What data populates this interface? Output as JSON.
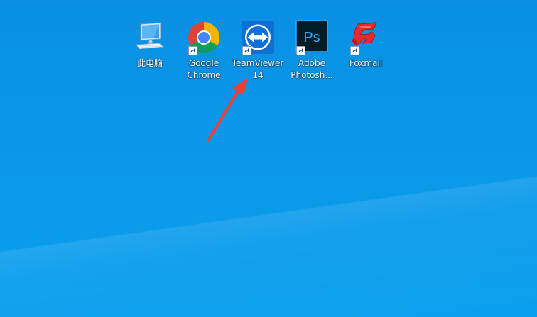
{
  "desktop": {
    "icons": [
      {
        "lines": [
          "此电脑"
        ],
        "icon": "this-pc-icon",
        "shortcut": false
      },
      {
        "lines": [
          "Google",
          "Chrome"
        ],
        "icon": "chrome-icon",
        "shortcut": true
      },
      {
        "lines": [
          "TeamViewer",
          "14"
        ],
        "icon": "teamviewer-icon",
        "shortcut": true
      },
      {
        "lines": [
          "Adobe",
          "Photosh..."
        ],
        "icon": "photoshop-icon",
        "shortcut": true
      },
      {
        "lines": [
          "Foxmail"
        ],
        "icon": "foxmail-icon",
        "shortcut": true
      }
    ],
    "photoshop_glyph": "Ps"
  },
  "colors": {
    "wallpaper": "#0b97e8",
    "annotation_arrow": "#e8413c",
    "teamviewer_blue": "#0e6fd6",
    "photoshop_bg": "#001d26",
    "photoshop_text": "#31a8ff",
    "foxmail_red": "#e52b2b"
  }
}
